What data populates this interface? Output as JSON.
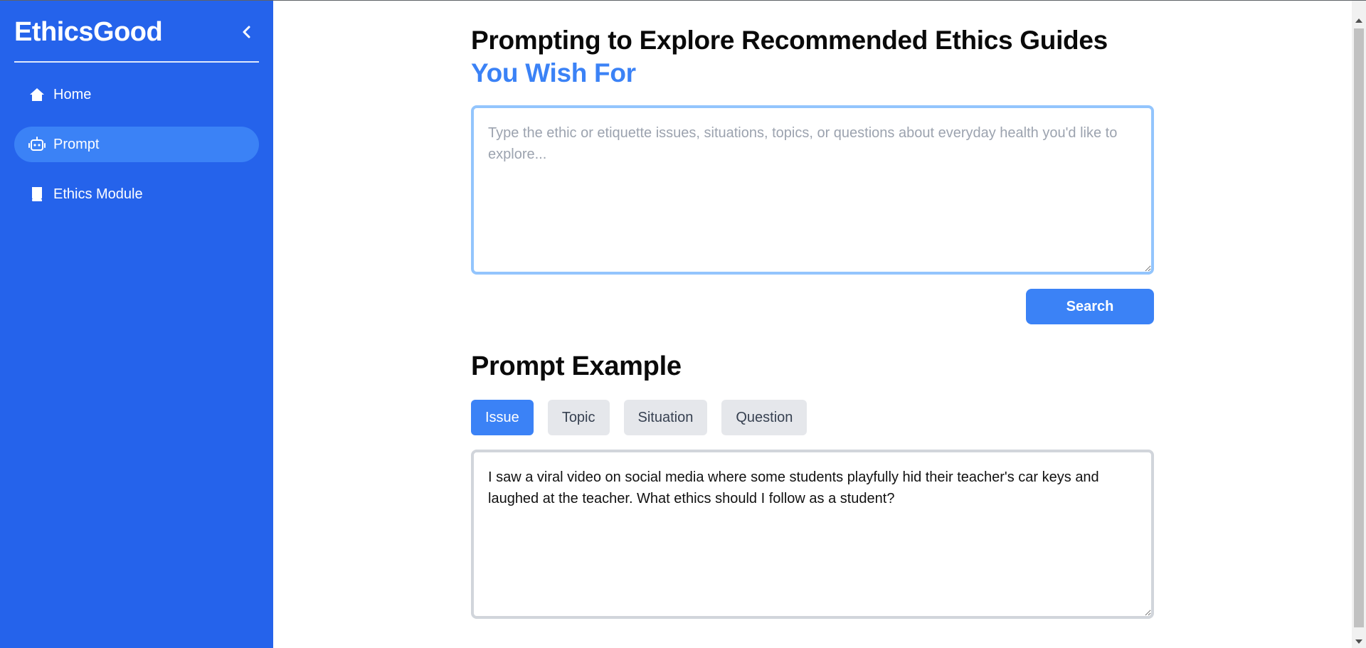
{
  "sidebar": {
    "brand": "EthicsGood",
    "collapse_icon": "chevron-left-icon",
    "items": [
      {
        "label": "Home",
        "icon": "home-icon",
        "active": false
      },
      {
        "label": "Prompt",
        "icon": "robot-icon",
        "active": true
      },
      {
        "label": "Ethics Module",
        "icon": "book-icon",
        "active": false
      }
    ]
  },
  "main": {
    "title_line1": "Prompting to Explore Recommended Ethics Guides",
    "title_line2": "You Wish For",
    "prompt_placeholder": "Type the ethic or etiquette issues, situations, topics, or questions about everyday health you'd like to explore...",
    "prompt_value": "",
    "search_label": "Search",
    "example_title": "Prompt Example",
    "tabs": [
      {
        "label": "Issue",
        "active": true
      },
      {
        "label": "Topic",
        "active": false
      },
      {
        "label": "Situation",
        "active": false
      },
      {
        "label": "Question",
        "active": false
      }
    ],
    "example_text": "I saw a viral video on social media where some students playfully hid their teacher's car keys and laughed at the teacher. What ethics should I follow as a student?"
  },
  "colors": {
    "sidebar_bg": "#2563eb",
    "accent": "#3b82f6",
    "active_nav_bg": "#3b82f6",
    "input_focus_border": "#93c5fd",
    "tab_inactive_bg": "#e5e7eb"
  }
}
